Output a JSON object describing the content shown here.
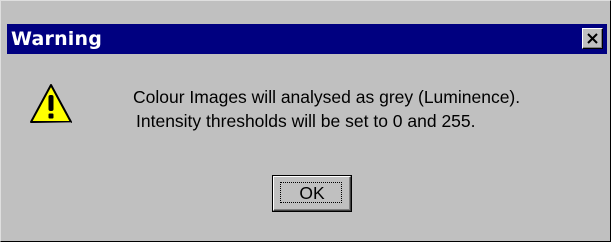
{
  "window": {
    "title": "Warning",
    "close_icon": "close-icon"
  },
  "dialog": {
    "icon": "warning-icon",
    "message_line1": "Colour Images will analysed as grey (Luminence).",
    "message_line2": "Intensity thresholds will be set to 0 and 255.",
    "ok_label": "OK"
  },
  "colors": {
    "titlebar": "#000080",
    "dialog_bg": "#c0c0c0",
    "warning_fill": "#ffff00"
  }
}
